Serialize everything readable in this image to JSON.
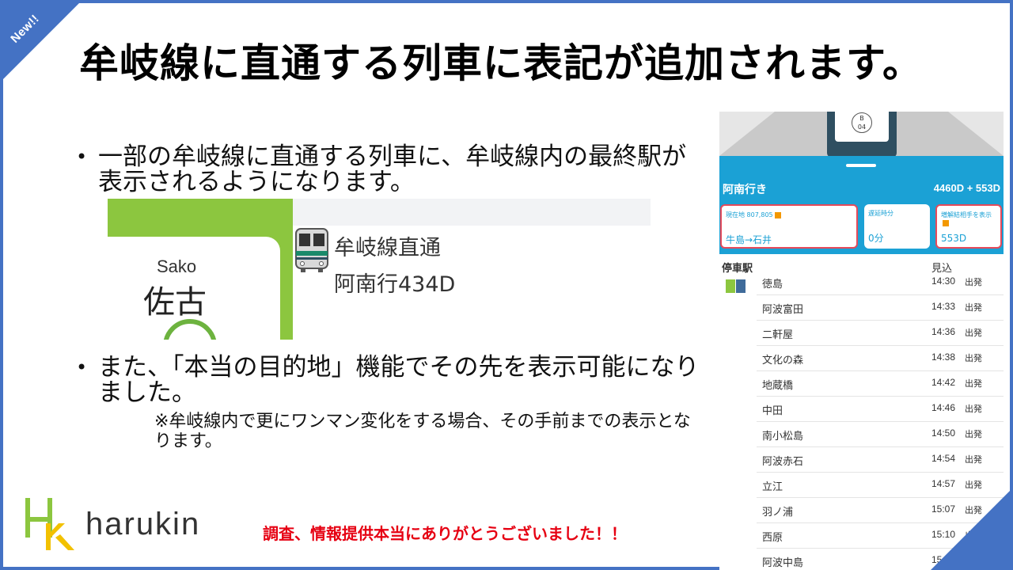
{
  "badge": "New!!",
  "title": "牟岐線に直通する列車に表記が追加されます。",
  "bullets": [
    {
      "text": "一部の牟岐線に直通する列車に、牟岐線内の最終駅が表示されるようになります。"
    },
    {
      "text": "また、「本当の目的地」機能でその先を表示可能になりました。"
    }
  ],
  "note": "※牟岐線内で更にワンマン変化をする場合、その手前までの表示となります。",
  "inset": {
    "station_en": "Sako",
    "station_jp": "佐古",
    "line1": "牟岐線直通",
    "line2": "阿南行434D"
  },
  "phone": {
    "badge": "B\n04",
    "destination": "阿南行き",
    "train_number": "4460D + 553D",
    "cards": [
      {
        "label": "現在地 807,805",
        "value": "牛島→石井"
      },
      {
        "label": "遅延時分",
        "value": "0分"
      },
      {
        "label": "増解結相手を表示",
        "value": "553D"
      }
    ],
    "header_station": "停車駅",
    "header_time": "見込",
    "stops": [
      {
        "station": "徳島",
        "time": "14:30",
        "type": "出発"
      },
      {
        "station": "阿波富田",
        "time": "14:33",
        "type": "出発"
      },
      {
        "station": "二軒屋",
        "time": "14:36",
        "type": "出発"
      },
      {
        "station": "文化の森",
        "time": "14:38",
        "type": "出発"
      },
      {
        "station": "地蔵橋",
        "time": "14:42",
        "type": "出発"
      },
      {
        "station": "中田",
        "time": "14:46",
        "type": "出発"
      },
      {
        "station": "南小松島",
        "time": "14:50",
        "type": "出発"
      },
      {
        "station": "阿波赤石",
        "time": "14:54",
        "type": "出発"
      },
      {
        "station": "立江",
        "time": "14:57",
        "type": "出発"
      },
      {
        "station": "羽ノ浦",
        "time": "15:07",
        "type": "出発"
      },
      {
        "station": "西原",
        "time": "15:10",
        "type": "出発"
      },
      {
        "station": "阿波中島",
        "time": "15:",
        "type": ""
      }
    ]
  },
  "logo_text": "harukin",
  "thanks": "調査、情報提供本当にありがとうございました！！",
  "colors": {
    "accent": "#4472c4",
    "thanks": "#e60012",
    "app_blue": "#1ba1d5",
    "line_green": "#8cc63f"
  }
}
